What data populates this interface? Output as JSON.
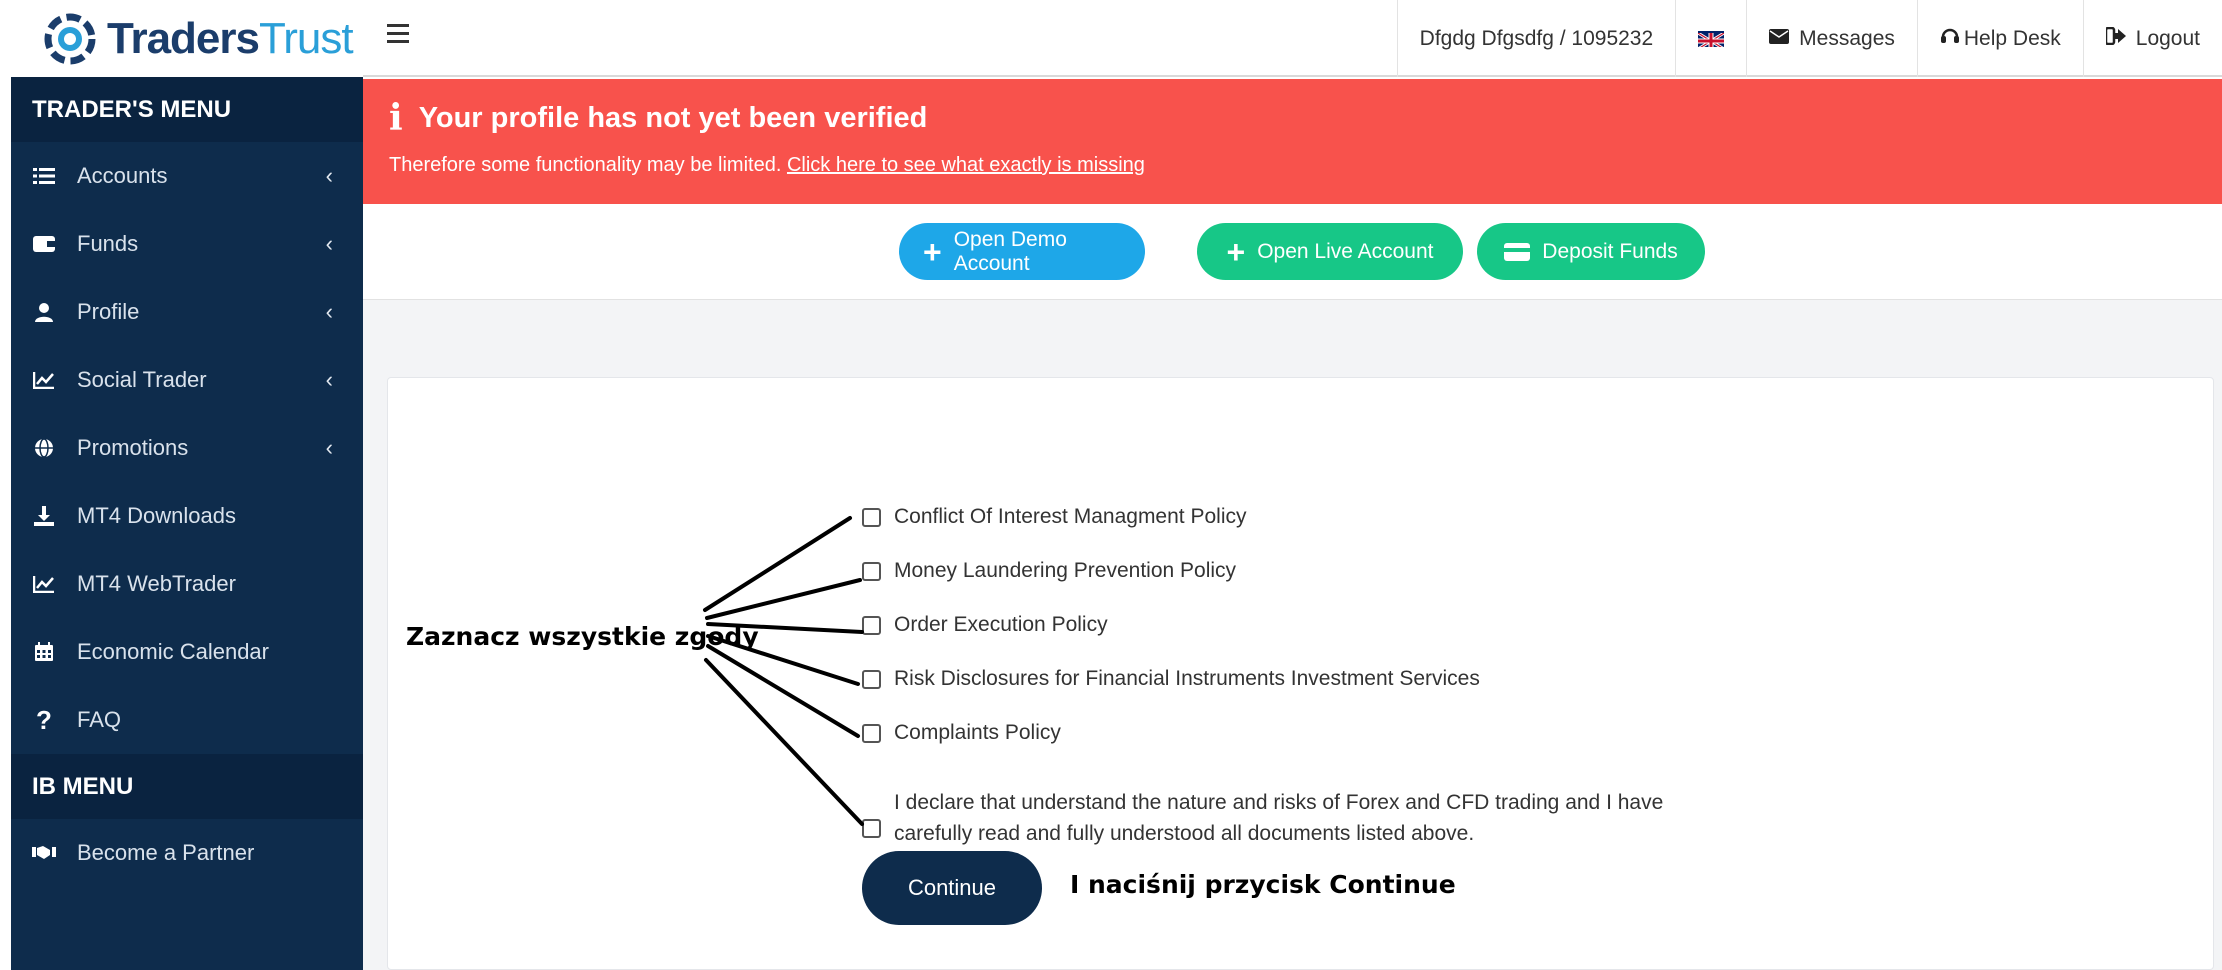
{
  "brand": {
    "logo_a": "Traders",
    "logo_b": "Trust"
  },
  "sidebar": {
    "traders_menu_title": "TRADER'S MENU",
    "items": [
      {
        "label": "Accounts",
        "icon": "list-icon",
        "has_chevron": true
      },
      {
        "label": "Funds",
        "icon": "wallet-icon",
        "has_chevron": true
      },
      {
        "label": "Profile",
        "icon": "user-icon",
        "has_chevron": true
      },
      {
        "label": "Social Trader",
        "icon": "chart-icon",
        "has_chevron": true
      },
      {
        "label": "Promotions",
        "icon": "globe-icon",
        "has_chevron": true
      },
      {
        "label": "MT4 Downloads",
        "icon": "download-icon",
        "has_chevron": false
      },
      {
        "label": "MT4 WebTrader",
        "icon": "chart-icon",
        "has_chevron": false
      },
      {
        "label": "Economic Calendar",
        "icon": "calendar-icon",
        "has_chevron": false
      },
      {
        "label": "FAQ",
        "icon": "question-icon",
        "has_chevron": false
      }
    ],
    "ib_menu_title": "IB MENU",
    "ib_items": [
      {
        "label": "Become a Partner",
        "icon": "handshake-icon"
      }
    ]
  },
  "topbar": {
    "user": "Dfgdg Dfgsdfg / 1095232",
    "messages": "Messages",
    "help_desk": "Help Desk",
    "logout": "Logout"
  },
  "alert": {
    "title": "Your profile has not yet been verified",
    "text": "Therefore some functionality may be limited.",
    "link": "Click here to see what exactly is missing"
  },
  "actions": {
    "open_demo": "Open Demo Account",
    "open_live": "Open Live Account",
    "deposit": "Deposit Funds"
  },
  "policies": [
    "Conflict Of Interest Managment Policy",
    "Money Laundering Prevention Policy",
    "Order Execution Policy",
    "Risk Disclosures for Financial Instruments Investment Services",
    "Complaints Policy"
  ],
  "declaration": {
    "line1": "I declare that understand the nature and risks of Forex and CFD trading and I have",
    "line2": "carefully read and fully understood all documents listed above."
  },
  "continue_label": "Continue",
  "annotations": {
    "left": "Zaznacz wszystkie zgody",
    "right": "I naciśnij przycisk Continue"
  },
  "colors": {
    "sidebar_bg": "#0e2c4c",
    "alert_bg": "#f8524c",
    "demo_btn": "#1ea7e8",
    "live_btn": "#17c787",
    "continue_btn": "#0e2c4c"
  }
}
